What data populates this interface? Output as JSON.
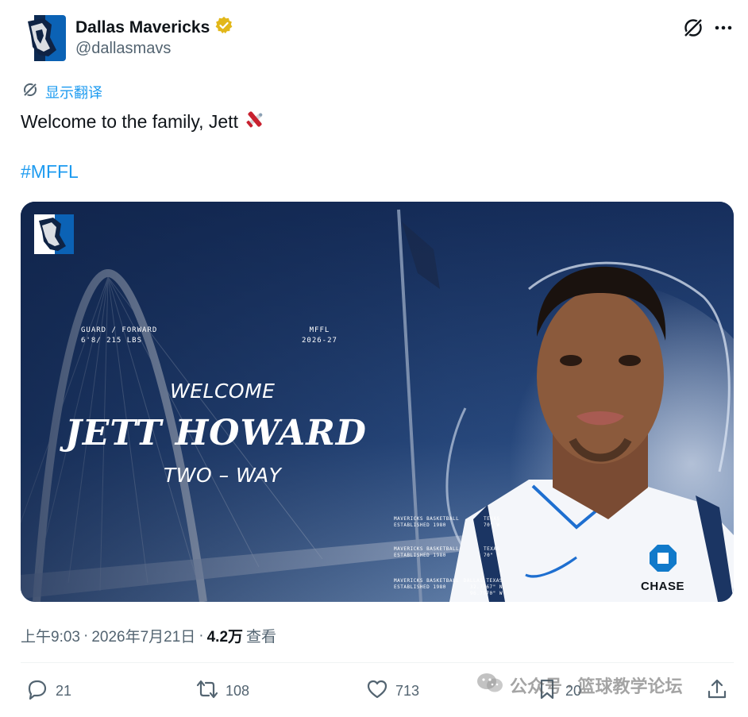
{
  "author": {
    "display_name": "Dallas Mavericks",
    "handle": "@dallasmavs",
    "verified_icon": "verified-badge-gold"
  },
  "translate_label": "显示翻译",
  "tweet": {
    "text": "Welcome to the family, Jett",
    "emoji": "airplane",
    "hashtag": "#MFFL"
  },
  "graphic": {
    "position_line1": "GUARD / FORWARD",
    "position_line2": "6'8/ 215 LBS",
    "team_line1": "MFFL",
    "team_line2": "2026-27",
    "welcome": "WELCOME",
    "player_name": "JETT HOWARD",
    "contract": "TWO – WAY",
    "fine_print": [
      {
        "left": "MAVERICKS BASKETBALL",
        "left2": "ESTABLISHED 1980",
        "right": "TEXAS",
        "right2": "70\" W"
      },
      {
        "left": "MAVERICKS BASKETBALL",
        "left2": "ESTABLISHED 1980",
        "right": "TEXAS",
        "right2": "70\" W"
      },
      {
        "left": "MAVERICKS BASKETBALL",
        "left2": "ESTABLISHED 1980",
        "right": "DALLAS TEXAS",
        "right2": "32.7767\" N 96.7970\" W"
      }
    ],
    "sponsor": "CHASE"
  },
  "meta": {
    "time": "上午9:03",
    "sep": "·",
    "date": "2026年7月21日",
    "views_count": "4.2万",
    "views_label": "查看"
  },
  "actions": {
    "replies": "21",
    "reposts": "108",
    "likes": "713",
    "bookmarks": "20"
  },
  "watermark": "公众号 · 篮球教学论坛",
  "colors": {
    "link_blue": "#1d9bf0",
    "muted": "#536471",
    "mavs_navy": "#1b3563"
  }
}
